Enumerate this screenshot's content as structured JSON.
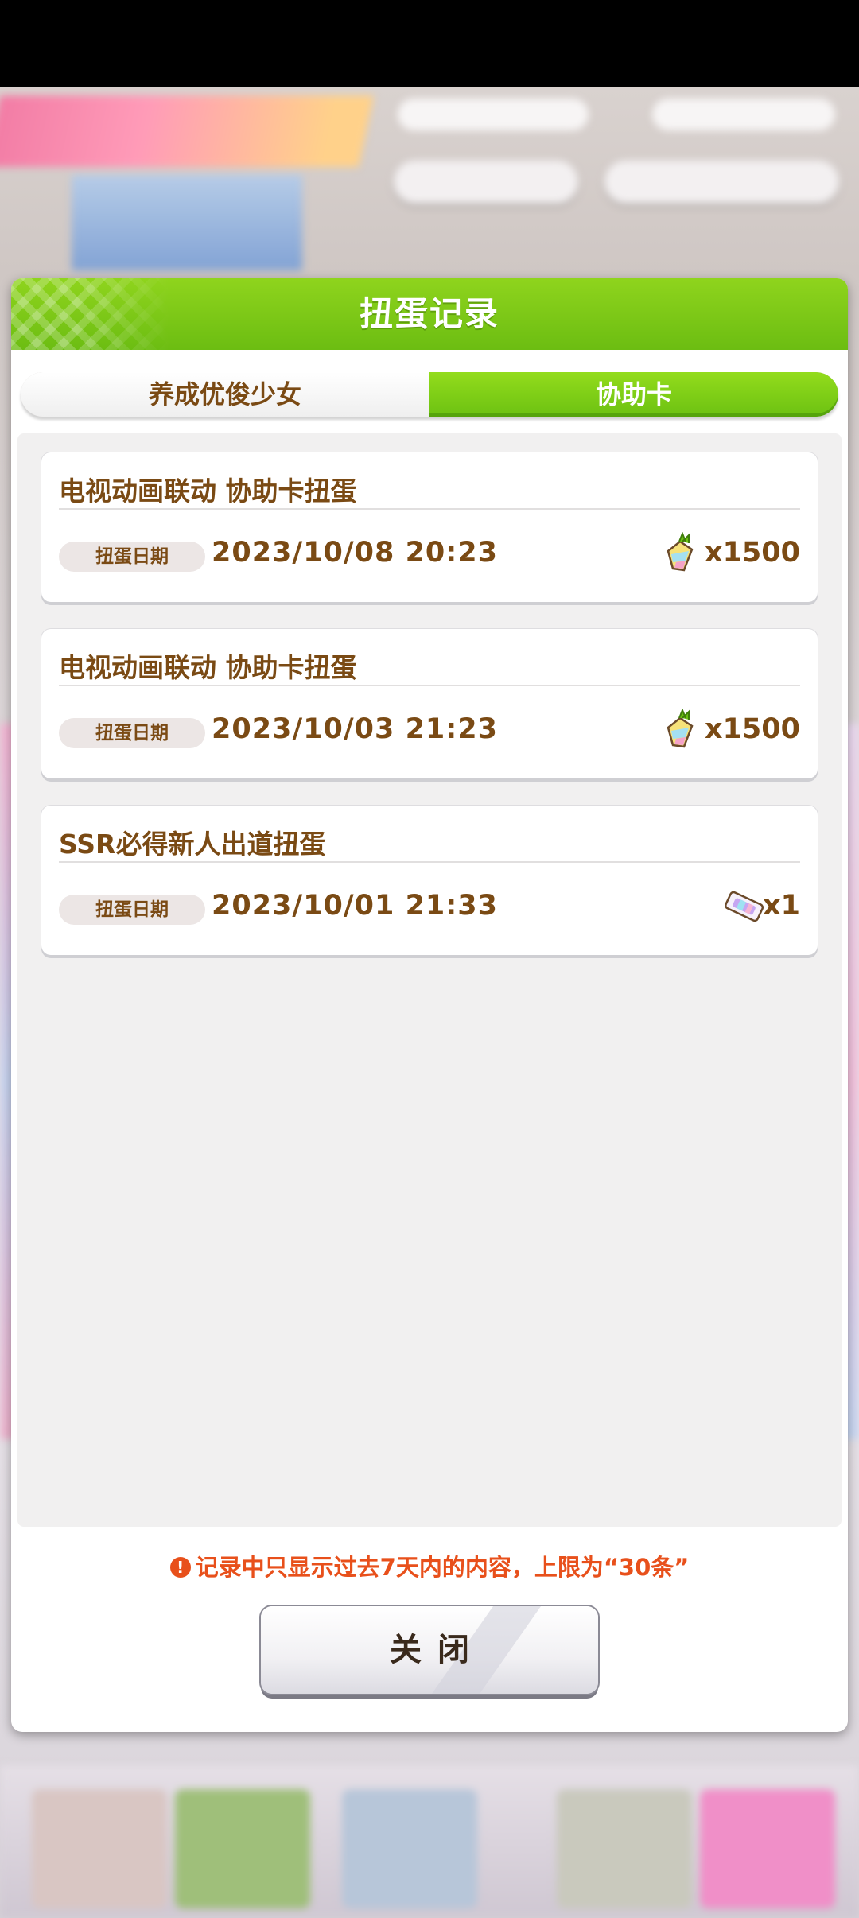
{
  "dialog": {
    "title": "扭蛋记录",
    "tabs": [
      {
        "label": "养成优俊少女",
        "selected": false
      },
      {
        "label": "协助卡",
        "selected": true
      }
    ],
    "records": [
      {
        "title": "电视动画联动  协助卡扭蛋",
        "date_label": "扭蛋日期",
        "date": "2023/10/08  20:23",
        "cost_icon": "carrot-jewel-icon",
        "cost": "x1500"
      },
      {
        "title": "电视动画联动  协助卡扭蛋",
        "date_label": "扭蛋日期",
        "date": "2023/10/03  21:23",
        "cost_icon": "carrot-jewel-icon",
        "cost": "x1500"
      },
      {
        "title": "SSR必得新人出道扭蛋",
        "date_label": "扭蛋日期",
        "date": "2023/10/01  21:33",
        "cost_icon": "gacha-ticket-icon",
        "cost": "x1"
      }
    ],
    "notice": "记录中只显示过去7天内的内容，上限为“30条”",
    "close_label": "关闭"
  },
  "colors": {
    "header_green": "#7cc817",
    "tab_active": "#86d31a",
    "text_brown": "#7a4a14",
    "notice_red": "#e8501b"
  }
}
